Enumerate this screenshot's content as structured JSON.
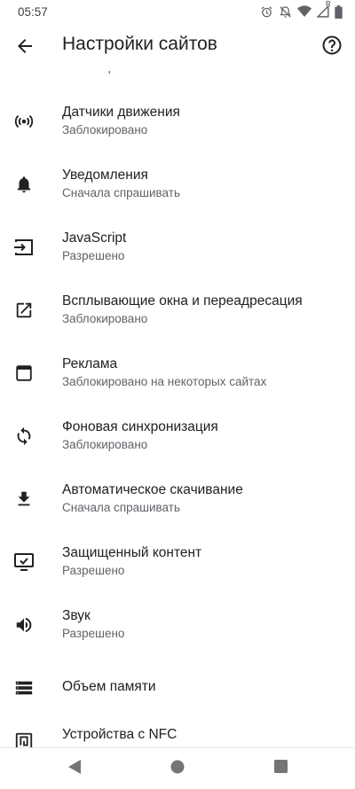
{
  "status_bar": {
    "time": "05:57",
    "icons": [
      "alarm-icon",
      "mute-icon",
      "wifi-icon",
      "signal-icon",
      "battery-icon"
    ],
    "signal_roaming": "R"
  },
  "header": {
    "title": "Настройки сайтов",
    "back_icon": "arrow-back-icon",
    "help_icon": "help-icon"
  },
  "settings": [
    {
      "icon": "generic-icon",
      "title": "",
      "subtitle": "Заблокировано"
    },
    {
      "icon": "motion-sensors-icon",
      "title": "Датчики движения",
      "subtitle": "Заблокировано"
    },
    {
      "icon": "bell-icon",
      "title": "Уведомления",
      "subtitle": "Сначала спрашивать"
    },
    {
      "icon": "javascript-icon",
      "title": "JavaScript",
      "subtitle": "Разрешено"
    },
    {
      "icon": "popup-icon",
      "title": "Всплывающие окна и переадресация",
      "subtitle": "Заблокировано"
    },
    {
      "icon": "ads-icon",
      "title": "Реклама",
      "subtitle": "Заблокировано на некоторых сайтах"
    },
    {
      "icon": "sync-icon",
      "title": "Фоновая синхронизация",
      "subtitle": "Заблокировано"
    },
    {
      "icon": "download-icon",
      "title": "Автоматическое скачивание",
      "subtitle": "Сначала спрашивать"
    },
    {
      "icon": "protected-content-icon",
      "title": "Защищенный контент",
      "subtitle": "Разрешено"
    },
    {
      "icon": "volume-icon",
      "title": "Звук",
      "subtitle": "Разрешено"
    },
    {
      "icon": "storage-icon",
      "title": "Объем памяти",
      "subtitle": ""
    },
    {
      "icon": "nfc-icon",
      "title": "Устройства с NFC",
      "subtitle": ""
    }
  ],
  "nav": {
    "back": "nav-back-icon",
    "home": "nav-home-icon",
    "recents": "nav-recents-icon"
  },
  "colors": {
    "text_primary": "#202124",
    "text_secondary": "#5f6368",
    "icon": "#202124",
    "nav_icon": "#757575"
  }
}
